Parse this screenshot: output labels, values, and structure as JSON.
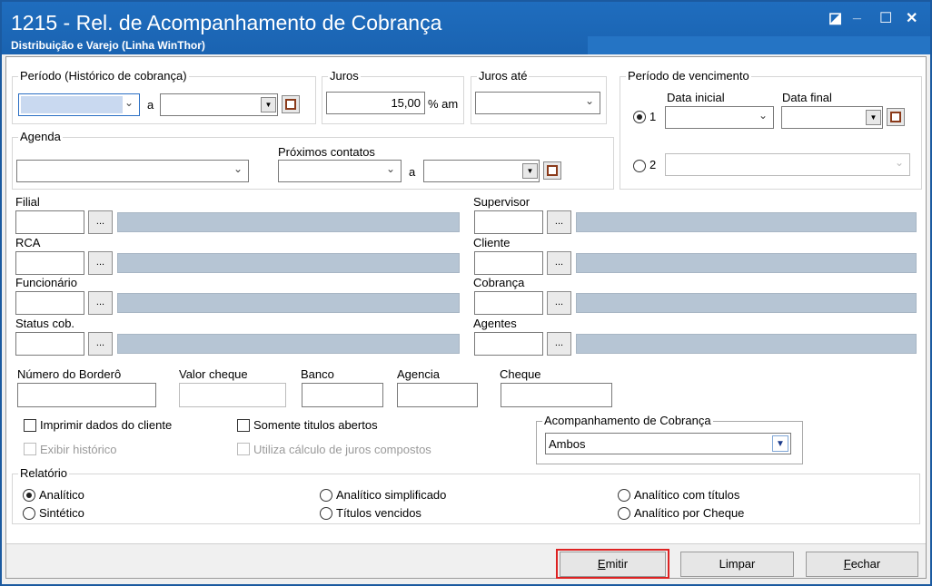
{
  "window": {
    "title": "1215 - Rel. de Acompanhamento de Cobrança",
    "subtitle": "Distribuição e Varejo (Linha WinThor)",
    "controls": {
      "restore": "◪",
      "minimize": "_",
      "maximize": "☐",
      "close": "✕"
    }
  },
  "periodo": {
    "label": "Período (Histórico de cobrança)",
    "sep": "a",
    "from_value": "",
    "to_value": ""
  },
  "juros": {
    "label": "Juros",
    "value": "15,00",
    "unit": "% am"
  },
  "juros_ate": {
    "label": "Juros até",
    "value": ""
  },
  "vencimento": {
    "label": "Período de vencimento",
    "data_inicial_label": "Data inicial",
    "data_final_label": "Data final",
    "opt1": "1",
    "opt2": "2"
  },
  "agenda": {
    "label": "Agenda",
    "proximos_label": "Próximos contatos",
    "sep": "a"
  },
  "lookups": {
    "filial": "Filial",
    "rca": "RCA",
    "funcionario": "Funcionário",
    "status": "Status cob.",
    "supervisor": "Supervisor",
    "cliente": "Cliente",
    "cobranca": "Cobrança",
    "agentes": "Agentes",
    "dots": "..."
  },
  "fields": {
    "bordero": "Número do Borderô",
    "valor_cheque": "Valor cheque",
    "banco": "Banco",
    "agencia": "Agencia",
    "cheque": "Cheque"
  },
  "options": {
    "imprimir": "Imprimir dados do cliente",
    "exibir": "Exibir histórico",
    "somente": "Somente titulos abertos",
    "utiliza": "Utiliza cálculo de juros compostos"
  },
  "acompanhamento": {
    "label": "Acompanhamento de Cobrança",
    "value": "Ambos"
  },
  "relatorio": {
    "label": "Relatório",
    "analitico": "Analítico",
    "sintetico": "Sintético",
    "analitico_simplificado": "Analítico simplificado",
    "titulos_vencidos": "Títulos vencidos",
    "analitico_titulos": "Analítico com títulos",
    "analitico_cheque": "Analítico por Cheque"
  },
  "buttons": {
    "emitir_key": "E",
    "emitir_rest": "mitir",
    "limpar": "Limpar",
    "fechar_key": "F",
    "fechar_rest": "echar"
  },
  "colors": {
    "title_bar": "#1a63b1",
    "highlight": "#d22222",
    "readonly_field": "#b6c5d4"
  },
  "icons": [
    "restore-icon",
    "minimize-icon",
    "maximize-icon",
    "close-icon",
    "chevron-down-icon",
    "calendar-icon"
  ]
}
